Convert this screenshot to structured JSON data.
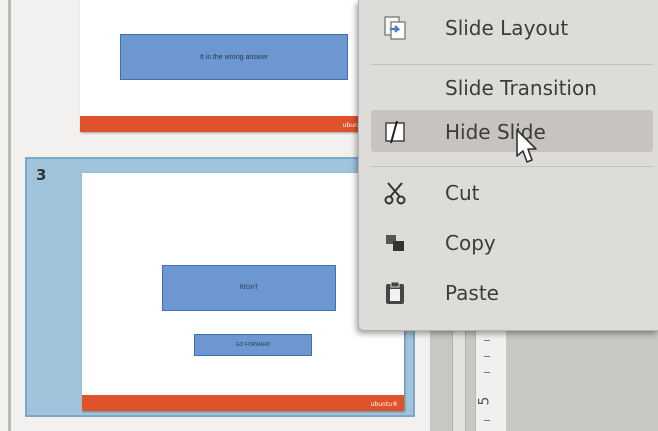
{
  "slide_panel": {
    "slide_2": {
      "text_box": "It is the wrong answer",
      "logo": "ubuntu"
    },
    "slide_3": {
      "number": "3",
      "box_right": "RIGHT",
      "box_forward": "GO FORWARD",
      "logo": "ubuntu®"
    }
  },
  "ruler": {
    "number": "5"
  },
  "context_menu": {
    "items": [
      {
        "label": "Slide Layout",
        "icon": "slide-layout-icon"
      },
      {
        "label": "Slide Transition",
        "icon": ""
      },
      {
        "label": "Hide Slide",
        "icon": "hide-slide-icon",
        "highlighted": true
      },
      {
        "label": "Cut",
        "icon": "scissors-icon"
      },
      {
        "label": "Copy",
        "icon": "copy-icon"
      },
      {
        "label": "Paste",
        "icon": "clipboard-icon"
      }
    ]
  },
  "colors": {
    "selection": "#9fc4dc",
    "slide_box": "#6d97d1",
    "footer_bar": "#e0522a",
    "menu_bg": "#dedcd8",
    "menu_highlight": "#c7c4c0"
  }
}
